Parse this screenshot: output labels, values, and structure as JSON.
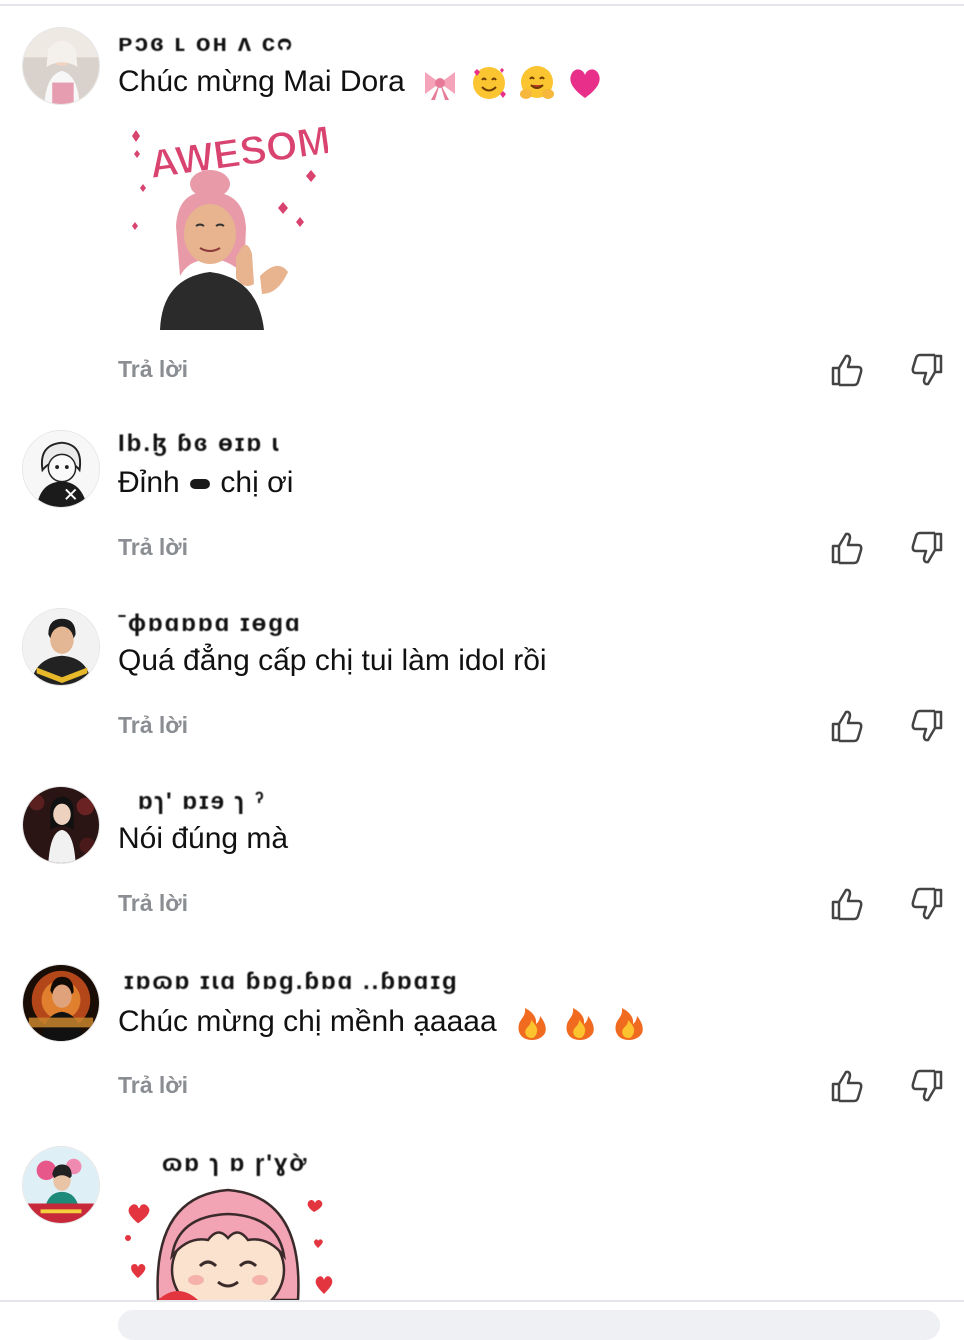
{
  "comments": [
    {
      "username": "ᴘɔɞ ʟ ᴏʜ ᴧ ᴄᴒ",
      "text": "Chúc mừng Mai Dora",
      "emojis": [
        "ribbon-icon",
        "smiling-face-with-hearts-icon",
        "hugging-face-icon",
        "pink-heart-icon"
      ],
      "sticker": {
        "name": "awesome-sticker",
        "caption": "AWESOME!"
      },
      "reply_label": "Trả lời"
    },
    {
      "username": "Ɩb.ɮ ɓɞ ɵɪɒ ɩ",
      "text_before": "Đỉnh",
      "text_after": "chị ơi",
      "reply_label": "Trả lời"
    },
    {
      "username": "ˉɸɒɑɒɒɑ ɪɵɡɑ",
      "text": "Quá đẳng cấp chị tui làm idol rồi",
      "reply_label": "Trả lời"
    },
    {
      "username": "ɒɿ' ɒɪɘ ɿ ˀ",
      "text": "Nói đúng mà",
      "reply_label": "Trả lời"
    },
    {
      "username": "ɪɒɷɒ ɪɩɑ ɓɒɡ.ɓɒɑ ..ɓɒɑɪɡ",
      "text": "Chúc mừng chị mềnh ạaaaa",
      "emojis": [
        "fire-icon",
        "fire-icon",
        "fire-icon"
      ],
      "reply_label": "Trả lời"
    },
    {
      "username": "ɷɒ ɿ ɒ ɼ'ɣờ",
      "sticker": {
        "name": "hearts-girl-sticker"
      }
    }
  ],
  "colors": {
    "reply_text": "#8a8d91",
    "heart_pink": "#e8308a",
    "sticker_pink": "#d94a78",
    "fire": "#f06a1f"
  }
}
